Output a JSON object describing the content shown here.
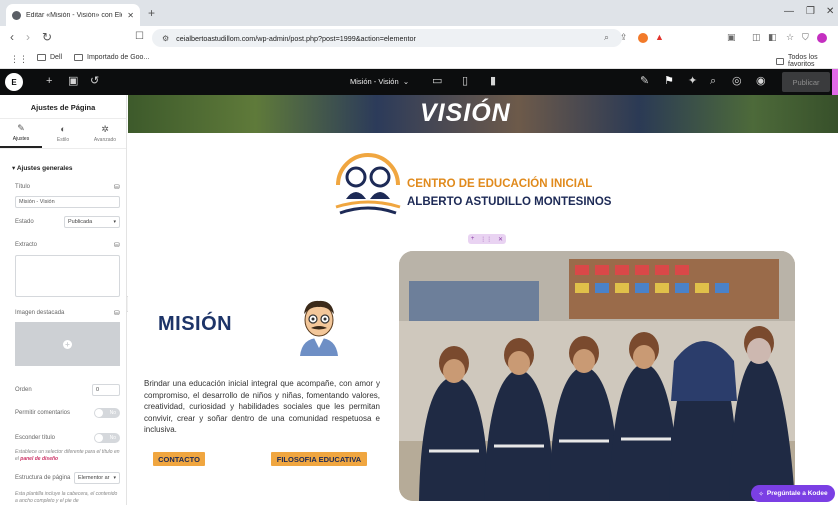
{
  "browser": {
    "tab_title": "Editar «Misión - Visión» con Elem",
    "tab_close": "✕",
    "new_tab": "+",
    "url": "ceialbertoastudillom.com/wp-admin/post.php?post=1999&action=elementor",
    "bookmarks": {
      "item1": "Dell",
      "item2": "Importado de Goo...",
      "all": "Todos los favoritos"
    }
  },
  "elementor": {
    "logo": "E",
    "document_title": "Misión - Visión",
    "publish_label": "Publicar"
  },
  "panel": {
    "title": "Ajustes de Página",
    "tabs": [
      {
        "icon": "wrench-icon",
        "label": "Ajustes"
      },
      {
        "icon": "half-circle-icon",
        "label": "Estilo"
      },
      {
        "icon": "gear-icon",
        "label": "Avanzado"
      }
    ],
    "section_title": "Ajustes generales",
    "title_label": "Título",
    "title_value": "Misión - Visión",
    "status_label": "Estado",
    "status_value": "Publicada",
    "excerpt_label": "Extracto",
    "featured_label": "Imagen destacada",
    "order_label": "Orden",
    "order_value": "0",
    "comments_label": "Permitir comentarios",
    "comments_toggle": "No",
    "hide_title_label": "Esconder título",
    "hide_title_toggle": "No",
    "hide_title_help": "Establece un selector diferente para el título en el",
    "hide_title_help_link": "panel de diseño",
    "structure_label": "Estructura de página",
    "structure_value": "Elementor ar",
    "structure_help": "Esta plantilla incluye la cabecera, el contenido a ancho completo y el pie de"
  },
  "page": {
    "hero_text": "VISIÓN",
    "school_line1": "CENTRO DE EDUCACIÓN INICIAL",
    "school_line2": "ALBERTO ASTUDILLO MONTESINOS",
    "mision_title": "MISIÓN",
    "mision_body": "Brindar una educación inicial integral que acompañe, con amor y compromiso, el desarrollo de niños y niñas, fomentando valores, creatividad, curiosidad y habilidades sociales que les permitan convivir, crear y soñar dentro de una comunidad respetuosa e inclusiva.",
    "btn_contacto": "CONTACTO",
    "btn_filosofia": "FILOSOFIA EDUCATIVA"
  },
  "widget": {
    "kodee": "Pregúntale a Kodee"
  },
  "colors": {
    "orange": "#f0a640",
    "navy": "#1d2a56",
    "elementor_bar": "#0c0d0e",
    "kodee": "#7b3fe4"
  }
}
